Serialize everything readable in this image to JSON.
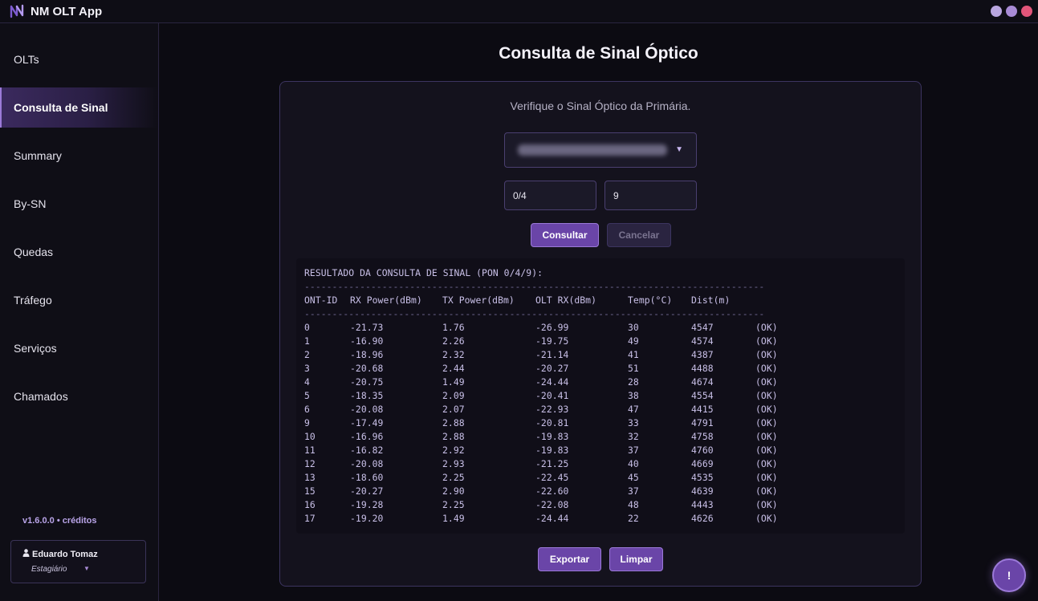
{
  "app": {
    "title": "NM OLT App"
  },
  "sidebar": {
    "items": [
      {
        "label": "OLTs"
      },
      {
        "label": "Consulta de Sinal"
      },
      {
        "label": "Summary"
      },
      {
        "label": "By-SN"
      },
      {
        "label": "Quedas"
      },
      {
        "label": "Tráfego"
      },
      {
        "label": "Serviços"
      },
      {
        "label": "Chamados"
      }
    ],
    "active_index": 1,
    "version": "v1.6.0.0 • créditos",
    "user": {
      "name": "Eduardo Tomaz",
      "role": "Estagiário"
    }
  },
  "main": {
    "title": "Consulta de Sinal Óptico",
    "subtitle": "Verifique o Sinal Óptico da Primária.",
    "pon_value": "0/4",
    "port_value": "9",
    "consultar_label": "Consultar",
    "cancelar_label": "Cancelar",
    "exportar_label": "Exportar",
    "limpar_label": "Limpar",
    "help_label": "!"
  },
  "result": {
    "heading": "RESULTADO DA CONSULTA DE SINAL (PON 0/4/9):",
    "separator": "-----------------------------------------------------------------------------------",
    "columns": [
      "ONT-ID",
      "RX Power(dBm)",
      "TX Power(dBm)",
      "OLT RX(dBm)",
      "Temp(°C)",
      "Dist(m)"
    ],
    "rows": [
      [
        "0",
        "-21.73",
        "1.76",
        "-26.99",
        "30",
        "4547",
        "(OK)"
      ],
      [
        "1",
        "-16.90",
        "2.26",
        "-19.75",
        "49",
        "4574",
        "(OK)"
      ],
      [
        "2",
        "-18.96",
        "2.32",
        "-21.14",
        "41",
        "4387",
        "(OK)"
      ],
      [
        "3",
        "-20.68",
        "2.44",
        "-20.27",
        "51",
        "4488",
        "(OK)"
      ],
      [
        "4",
        "-20.75",
        "1.49",
        "-24.44",
        "28",
        "4674",
        "(OK)"
      ],
      [
        "5",
        "-18.35",
        "2.09",
        "-20.41",
        "38",
        "4554",
        "(OK)"
      ],
      [
        "6",
        "-20.08",
        "2.07",
        "-22.93",
        "47",
        "4415",
        "(OK)"
      ],
      [
        "9",
        "-17.49",
        "2.88",
        "-20.81",
        "33",
        "4791",
        "(OK)"
      ],
      [
        "10",
        "-16.96",
        "2.88",
        "-19.83",
        "32",
        "4758",
        "(OK)"
      ],
      [
        "11",
        "-16.82",
        "2.92",
        "-19.83",
        "37",
        "4760",
        "(OK)"
      ],
      [
        "12",
        "-20.08",
        "2.93",
        "-21.25",
        "40",
        "4669",
        "(OK)"
      ],
      [
        "13",
        "-18.60",
        "2.25",
        "-22.45",
        "45",
        "4535",
        "(OK)"
      ],
      [
        "15",
        "-20.27",
        "2.90",
        "-22.60",
        "37",
        "4639",
        "(OK)"
      ],
      [
        "16",
        "-19.28",
        "2.25",
        "-22.08",
        "48",
        "4443",
        "(OK)"
      ],
      [
        "17",
        "-19.20",
        "1.49",
        "-24.44",
        "22",
        "4626",
        "(OK)"
      ]
    ]
  },
  "colors": {
    "accent": "#6a45a8",
    "accent_light": "#9b79d8",
    "background": "#0c0b12"
  }
}
